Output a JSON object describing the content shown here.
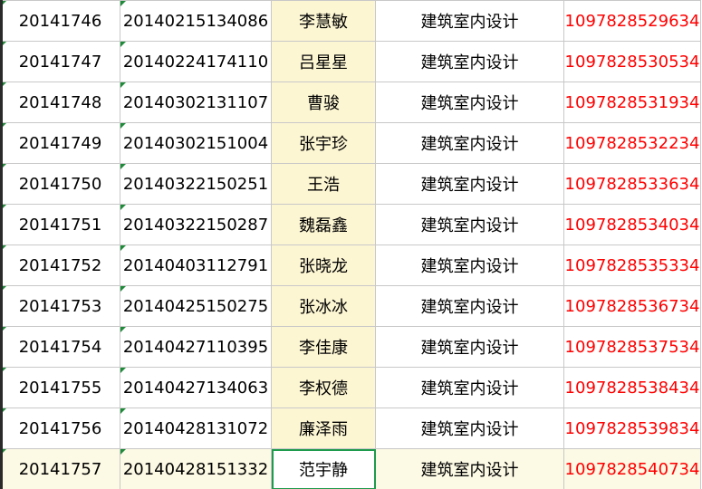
{
  "colors": {
    "phone_text": "#ff0000",
    "name_column_fill": "#fdf6d3",
    "selection_border": "#1e9b4c",
    "error_triangle": "#1f8a3a"
  },
  "rows": [
    {
      "num": "20141746",
      "id": "20140215134086",
      "name": "李慧敏",
      "major": "建筑室内设计",
      "phone": "1097828529634"
    },
    {
      "num": "20141747",
      "id": "20140224174110",
      "name": "吕星星",
      "major": "建筑室内设计",
      "phone": "1097828530534"
    },
    {
      "num": "20141748",
      "id": "20140302131107",
      "name": "曹骏",
      "major": "建筑室内设计",
      "phone": "1097828531934"
    },
    {
      "num": "20141749",
      "id": "20140302151004",
      "name": "张宇珍",
      "major": "建筑室内设计",
      "phone": "1097828532234"
    },
    {
      "num": "20141750",
      "id": "20140322150251",
      "name": "王浩",
      "major": "建筑室内设计",
      "phone": "1097828533634"
    },
    {
      "num": "20141751",
      "id": "20140322150287",
      "name": "魏磊鑫",
      "major": "建筑室内设计",
      "phone": "1097828534034"
    },
    {
      "num": "20141752",
      "id": "20140403112791",
      "name": "张晓龙",
      "major": "建筑室内设计",
      "phone": "1097828535334"
    },
    {
      "num": "20141753",
      "id": "20140425150275",
      "name": "张冰冰",
      "major": "建筑室内设计",
      "phone": "1097828536734"
    },
    {
      "num": "20141754",
      "id": "20140427110395",
      "name": "李佳康",
      "major": "建筑室内设计",
      "phone": "1097828537534"
    },
    {
      "num": "20141755",
      "id": "20140427134063",
      "name": "李权德",
      "major": "建筑室内设计",
      "phone": "1097828538434"
    },
    {
      "num": "20141756",
      "id": "20140428131072",
      "name": "廉泽雨",
      "major": "建筑室内设计",
      "phone": "1097828539834"
    },
    {
      "num": "20141757",
      "id": "20140428151332",
      "name": "范宇静",
      "major": "建筑室内设计",
      "phone": "1097828540734"
    }
  ]
}
